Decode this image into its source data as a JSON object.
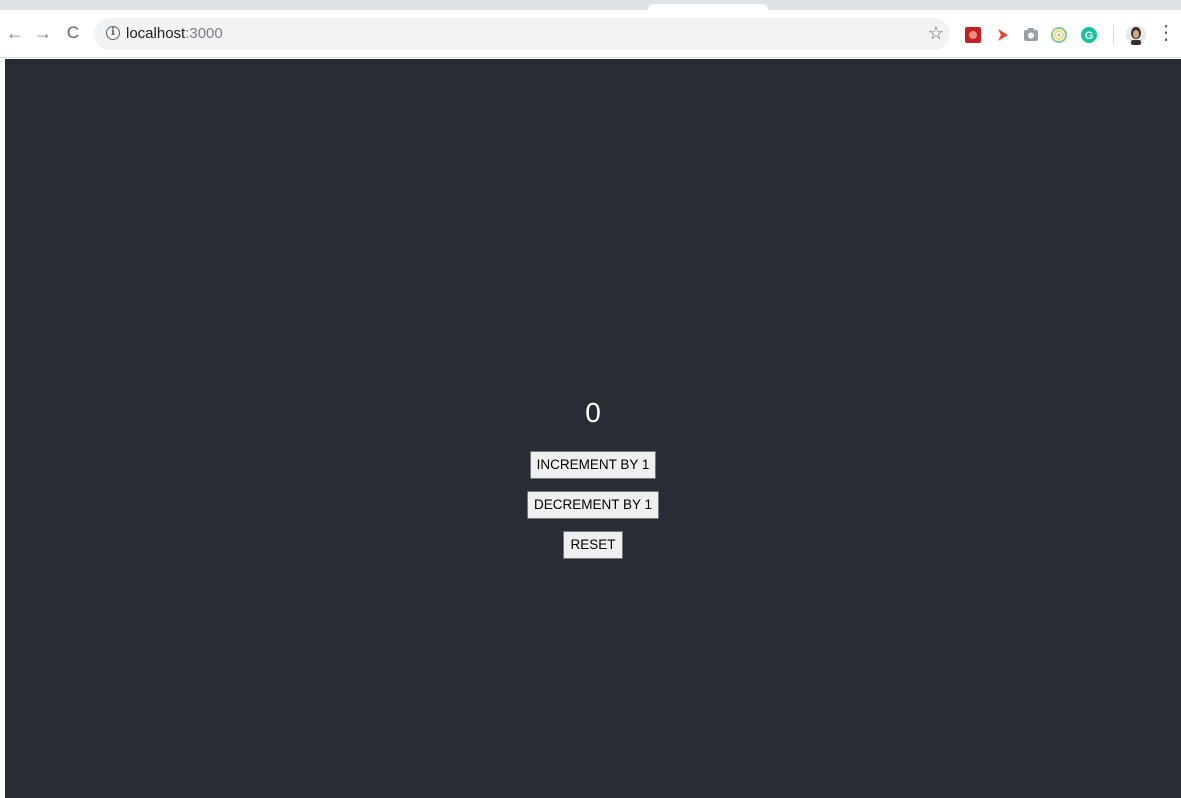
{
  "browser": {
    "url_host": "localhost",
    "url_port": ":3000",
    "nav": {
      "back": "←",
      "forward": "→",
      "reload": "C"
    },
    "info_icon": "i",
    "star_glyph": "☆",
    "menu_glyph": "⋮",
    "extensions": [
      "red-extension-icon",
      "red-arrow-extension-icon",
      "camera-extension-icon",
      "circle-extension-icon",
      "grammarly-extension-icon"
    ],
    "grammarly_letter": "G",
    "colors": {
      "grammarly": "#15c39a",
      "ext_red": "#d93025"
    }
  },
  "app": {
    "count": "0",
    "increment_label": "INCREMENT BY 1",
    "decrement_label": "DECREMENT BY 1",
    "reset_label": "RESET",
    "background": "#282c34"
  }
}
